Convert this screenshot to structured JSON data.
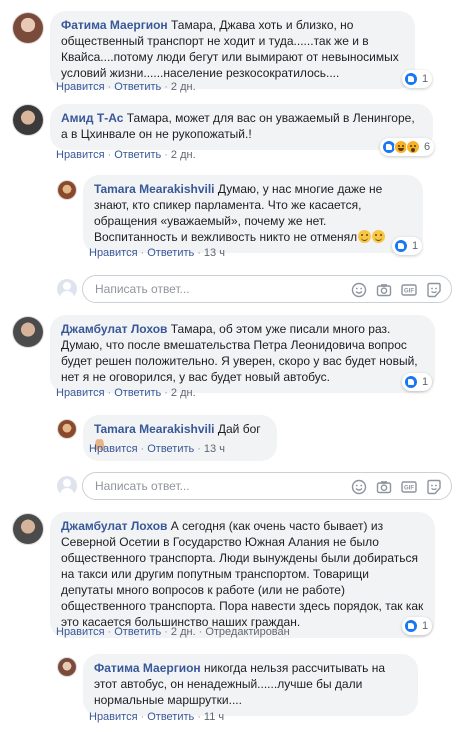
{
  "colors": {
    "link": "#385898",
    "bubble": "#f2f3f5",
    "meta": "#606770",
    "like": "#1877f2"
  },
  "comments": [
    {
      "author": "Фатима Маергион",
      "text": "Тамара, Джава хоть и близко, но общественный транспорт не ходит и туда......так же и в Квайса....потому люди бегут или вымирают от невыносимых условий жизни......население резкосократилось....",
      "like": "Нравится",
      "reply": "Ответить",
      "time": "2 дн.",
      "reaction_count": "1",
      "reactions": [
        "like-icon"
      ]
    },
    {
      "author": "Амид Т-Ас",
      "text": "Тамара, может для вас он уважаемый в Ленингоре, а в Цхинвале он не рукопожатый.!",
      "like": "Нравится",
      "reply": "Ответить",
      "time": "2 дн.",
      "reaction_count": "6",
      "reactions": [
        "like-icon",
        "haha-icon",
        "wow-icon"
      ]
    },
    {
      "author": "Tamara Mearakishvili",
      "text": "Думаю, у нас многие даже не знают, кто спикер парламента. Что же касается, обращения «уважаемый», почему же нет. Воспитанность и вежливость никто не отменял",
      "like": "Нравится",
      "reply": "Ответить",
      "time": "13 ч",
      "reaction_count": "1",
      "reactions": [
        "like-icon"
      ]
    },
    {
      "author": "Джамбулат Лохов",
      "text": "Тамара, об этом уже писали много раз. Думаю, что после вмешательства Петра Леонидовича вопрос будет решен положительно. Я уверен, скоро у вас будет новый, нет я не оговорился, у вас будет новый автобус.",
      "like": "Нравится",
      "reply": "Ответить",
      "time": "2 дн.",
      "reaction_count": "1",
      "reactions": [
        "like-icon"
      ]
    },
    {
      "author": "Tamara Mearakishvili",
      "text": "Дай бог",
      "like": "Нравится",
      "reply": "Ответить",
      "time": "13 ч"
    },
    {
      "author": "Джамбулат Лохов",
      "text": "А сегодня (как очень часто бывает) из Северной Осетии в Государство Южная Алания не было общественного транспорта. Люди вынуждены были добираться на такси или другим попутным транспортом. Товарищи депутаты много вопросов к работе (или не работе) общественного транспорта. Пора навести здесь порядок, так как это касается большинство наших граждан.",
      "like": "Нравится",
      "reply": "Ответить",
      "time": "2 дн.",
      "edited": "Отредактирован",
      "reaction_count": "1",
      "reactions": [
        "like-icon"
      ]
    },
    {
      "author": "Фатима Маергион",
      "text": "никогда нельзя рассчитывать на этот автобус, он ненадежный......лучше бы дали нормальные маршрутки....",
      "like": "Нравится",
      "reply": "Ответить",
      "time": "11 ч"
    }
  ],
  "reply_boxes": [
    {
      "placeholder": "Написать ответ..."
    },
    {
      "placeholder": "Написать ответ..."
    }
  ],
  "reply_tools": [
    "emoji-icon",
    "camera-icon",
    "gif-icon",
    "sticker-icon"
  ]
}
